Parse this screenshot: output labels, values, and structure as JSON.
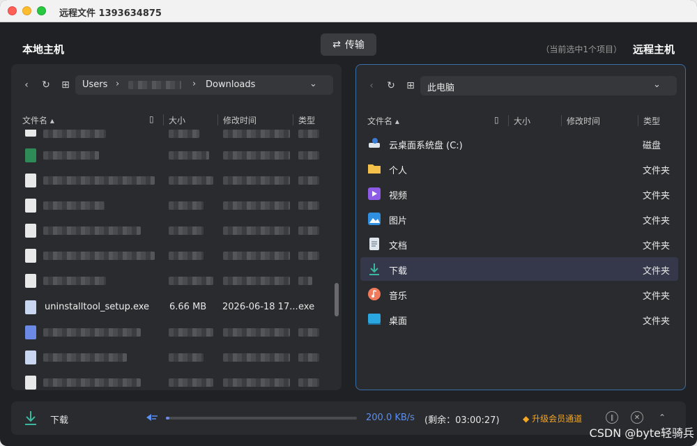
{
  "window": {
    "title": "远程文件 1393634875"
  },
  "header": {
    "local_host": "本地主机",
    "remote_host": "远程主机",
    "transfer_button": "传输",
    "selection_count": "（当前选中1个项目）"
  },
  "left_panel": {
    "path": {
      "segment1": "Users",
      "segment3": "Downloads"
    },
    "columns": {
      "name": "文件名",
      "size": "大小",
      "modified": "修改时间",
      "type": "类型"
    },
    "visible_row": {
      "name": "uninstalltool_setup.exe",
      "size": "6.66 MB",
      "modified": "2026-06-18 17...",
      "type": "exe"
    }
  },
  "right_panel": {
    "path": "此电脑",
    "columns": {
      "name": "文件名",
      "size": "大小",
      "modified": "修改时间",
      "type": "类型"
    },
    "rows": [
      {
        "name": "云桌面系统盘 (C:)",
        "type": "磁盘",
        "icon": "drive-icon"
      },
      {
        "name": "个人",
        "type": "文件夹",
        "icon": "folder-icon"
      },
      {
        "name": "视频",
        "type": "文件夹",
        "icon": "video-icon"
      },
      {
        "name": "图片",
        "type": "文件夹",
        "icon": "picture-icon"
      },
      {
        "name": "文档",
        "type": "文件夹",
        "icon": "document-icon"
      },
      {
        "name": "下载",
        "type": "文件夹",
        "icon": "download-icon"
      },
      {
        "name": "音乐",
        "type": "文件夹",
        "icon": "music-icon"
      },
      {
        "name": "桌面",
        "type": "文件夹",
        "icon": "desktop-icon"
      }
    ],
    "selected_index": 5
  },
  "transfer_bar": {
    "label": "下载",
    "speed": "200.0 KB/s",
    "remaining": "(剩余：03:00:27)",
    "progress": 0.02,
    "vip_label": "升级会员通道"
  },
  "watermark": "CSDN @byte轻骑兵",
  "colors": {
    "accent": "#5b8ff0",
    "vip": "#f5a623",
    "selection": "#34384a",
    "active_border": "#3a6ea8"
  }
}
